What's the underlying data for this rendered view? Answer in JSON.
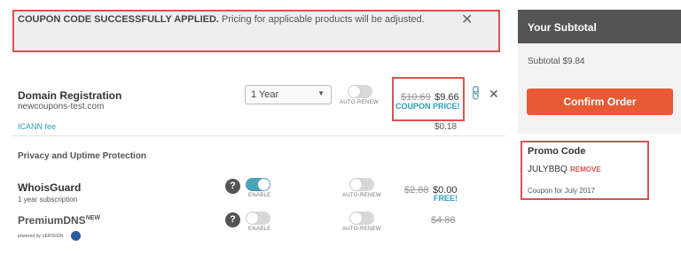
{
  "notice": {
    "bold_text": "COUPON CODE SUCCESSFULLY APPLIED.",
    "text": " Pricing for applicable products will be adjusted.",
    "close_glyph": "✕"
  },
  "domain": {
    "name": "Domain Registration",
    "domain": "newcoupons-test.com",
    "period": "1 Year",
    "auto_renew_label": "AUTO-RENEW",
    "old_price": "$10.69",
    "new_price": "$9.66",
    "coupon_label": "COUPON PRICE!",
    "icann_label": "ICANN fee",
    "icann_price": "$0.18"
  },
  "section_title": "Privacy and Uptime Protection",
  "whoisguard": {
    "name": "WhoisGuard",
    "sub": "1 year subscription",
    "enable_label": "ENABLE",
    "auto_renew_label": "AUTO-RENEW",
    "old_price": "$2.88",
    "new_price": "$0.00",
    "free_label": "FREE!",
    "help": "?"
  },
  "premiumdns": {
    "name": "PremiumDNS",
    "badge": "NEW",
    "enable_label": "ENABLE",
    "auto_renew_label": "AUTO-RENEW",
    "old_price": "$4.88",
    "help": "?",
    "powered_by": "powered by VERISIGN"
  },
  "sidebar": {
    "title": "Your Subtotal",
    "subtotal": "Subtotal $9.84",
    "confirm_label": "Confirm Order",
    "promo_title": "Promo Code",
    "promo_code": "JULYBBQ",
    "remove_label": "REMOVE",
    "promo_desc": "Coupon for July 2017"
  },
  "colors": {
    "accent": "#e85a33",
    "teal": "#2a9fb9",
    "highlight_border": "#d9534f"
  },
  "icons": [
    "close-icon",
    "chevron-down-icon",
    "link-icon",
    "remove-icon",
    "help-icon",
    "verisign-logo"
  ]
}
